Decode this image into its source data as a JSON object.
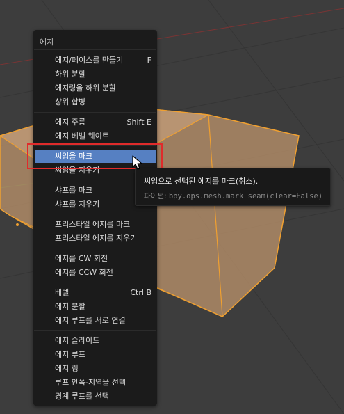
{
  "menu": {
    "title": "에지",
    "groups": [
      [
        {
          "label": "에지/페이스를 만들기",
          "shortcut": "F"
        },
        {
          "label": "하위 분할",
          "shortcut": ""
        },
        {
          "label": "에지링을 하위 분할",
          "shortcut": ""
        },
        {
          "label": "상위 합병",
          "shortcut": ""
        }
      ],
      [
        {
          "label": "에지 주름",
          "shortcut": "Shift E"
        },
        {
          "label": "에지 베벨 웨이트",
          "shortcut": ""
        }
      ],
      [
        {
          "label": "씨임을 마크",
          "shortcut": ""
        },
        {
          "label": "씨임을 지우기",
          "shortcut": ""
        }
      ],
      [
        {
          "label": "샤프를 마크",
          "shortcut": ""
        },
        {
          "label": "샤프를 지우기",
          "shortcut": ""
        }
      ],
      [
        {
          "label": "프리스타일 에지를 마크",
          "shortcut": ""
        },
        {
          "label": "프리스타일 에지를 지우기",
          "shortcut": ""
        }
      ],
      [
        {
          "label_pre": "에지를 ",
          "label_u": "C",
          "label_post": "W 회전",
          "shortcut": ""
        },
        {
          "label_pre": "에지를 CC",
          "label_u": "W",
          "label_post": " 회전",
          "shortcut": ""
        }
      ],
      [
        {
          "label": "베벨",
          "shortcut": "Ctrl B"
        },
        {
          "label": "에지 분할",
          "shortcut": ""
        },
        {
          "label": "에지 루프를 서로 연결",
          "shortcut": ""
        }
      ],
      [
        {
          "label": "에지 슬라이드",
          "shortcut": ""
        },
        {
          "label": "에지 루프",
          "shortcut": ""
        },
        {
          "label": "에지 링",
          "shortcut": ""
        },
        {
          "label": "루프 안쪽-지역을 선택",
          "shortcut": ""
        },
        {
          "label": "경계 루프를 선택",
          "shortcut": ""
        }
      ]
    ]
  },
  "tooltip": {
    "title": "씨임으로 선택된 에지를 마크(취소).",
    "python_prefix": "파이썬: ",
    "python_code": "bpy.ops.mesh.mark_seam(clear=False)"
  },
  "colors": {
    "viewport_bg": "#3d3d3d",
    "menu_bg": "#1b1b1b",
    "highlight": "#5680c2",
    "annotation_box": "#e02b2b",
    "mesh_face": "#b8916a",
    "mesh_edge": "#f0a030"
  }
}
